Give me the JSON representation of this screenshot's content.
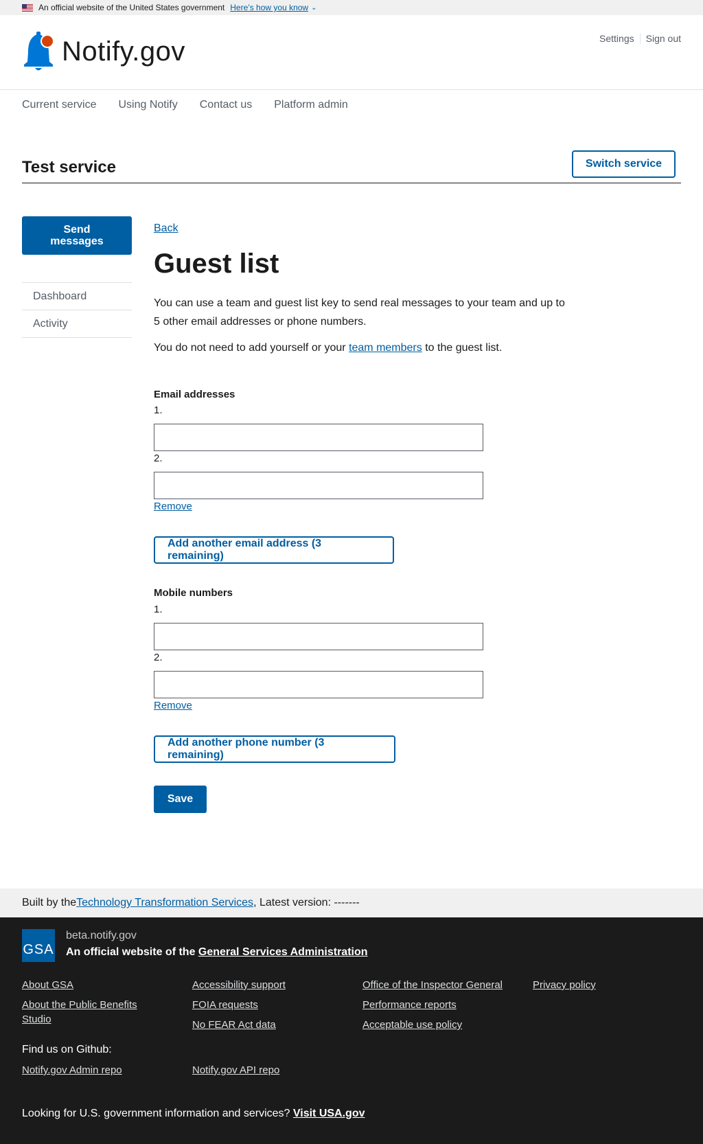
{
  "gov_banner": {
    "text": "An official website of the United States government",
    "how_link": "Here’s how you know"
  },
  "header": {
    "logo_text": "Notify.gov",
    "util_nav": [
      "Settings",
      "Sign out"
    ],
    "primary_nav": [
      "Current service",
      "Using Notify",
      "Contact us",
      "Platform admin"
    ]
  },
  "service": {
    "name": "Test service",
    "switch_label": "Switch service"
  },
  "sidebar": {
    "send_label": "Send messages",
    "items": [
      "Dashboard",
      "Activity"
    ]
  },
  "main": {
    "back_label": "Back",
    "title": "Guest list",
    "lead": "You can use a team and guest list key to send real messages to your team and up to 5 other email addresses or phone numbers.",
    "lead2_pre": "You do not need to add yourself or your ",
    "lead2_link": "team members",
    "lead2_post": " to the guest list.",
    "email": {
      "label": "Email addresses",
      "fields": [
        {
          "number": "1.",
          "value": ""
        },
        {
          "number": "2.",
          "value": ""
        }
      ],
      "remove_label": "Remove",
      "add_label": "Add another email address (3 remaining)"
    },
    "mobile": {
      "label": "Mobile numbers",
      "fields": [
        {
          "number": "1.",
          "value": ""
        },
        {
          "number": "2.",
          "value": ""
        }
      ],
      "remove_label": "Remove",
      "add_label": "Add another phone number (3 remaining)"
    },
    "save_label": "Save"
  },
  "footer": {
    "built_pre": "Built by the ",
    "built_link": "Technology Transformation Services",
    "built_post": ", Latest version: -------",
    "gsa_logo": "GSA",
    "domain": "beta.notify.gov",
    "official_pre": "An official website of the ",
    "official_link": "General Services Administration",
    "links_col1": [
      "About GSA",
      "About the Public Benefits Studio"
    ],
    "links_col2": [
      "Accessibility support",
      "FOIA requests",
      "No FEAR Act data"
    ],
    "links_col3": [
      "Office of the Inspector General",
      "Performance reports",
      "Acceptable use policy"
    ],
    "links_col4": [
      "Privacy policy"
    ],
    "github_heading": "Find us on Github:",
    "github_links": [
      "Notify.gov Admin repo",
      "Notify.gov API repo"
    ],
    "looking_pre": "Looking for U.S. government information and services? ",
    "looking_link": "Visit USA.gov"
  },
  "colors": {
    "primary": "#005ea2",
    "bell_blue": "#0076d6",
    "bell_dot": "#d54309",
    "footer_dark": "#1b1b1b"
  },
  "icons": [
    "us-flag-icon",
    "chevron-down-icon",
    "notify-bell-icon",
    "gsa-logo"
  ]
}
